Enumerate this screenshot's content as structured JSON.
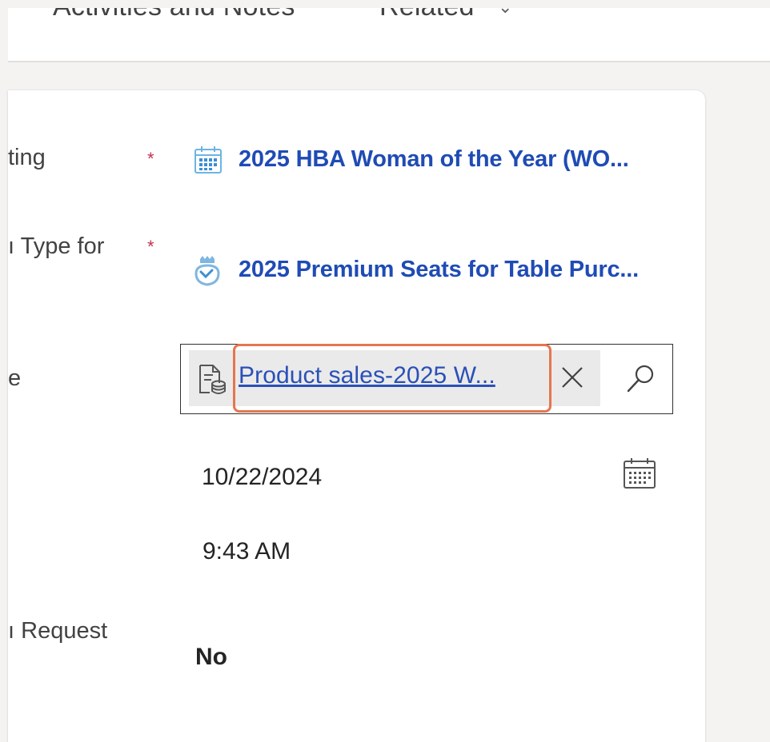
{
  "tabs": [
    {
      "label": "Activities and Notes"
    },
    {
      "label": "Related"
    }
  ],
  "fields": {
    "meeting": {
      "label": "ting",
      "required": "*",
      "value": "2025 HBA Woman of the Year (WO...",
      "icon": "calendar-grid-icon"
    },
    "type_for": {
      "label": "Type for",
      "required": "*",
      "value": "2025 Premium Seats for Table Purc...",
      "icon": "handshake-icon"
    },
    "price_list": {
      "label": "e",
      "value": "Product sales-2025 W...",
      "icon": "document-db-icon"
    },
    "date": {
      "value": "10/22/2024",
      "icon": "calendar-icon"
    },
    "time": {
      "value": "9:43 AM"
    },
    "request": {
      "label": "Request",
      "value": "No"
    }
  },
  "colors": {
    "link": "#1f4bb5",
    "required": "#c4314b",
    "highlight": "#e5754f"
  }
}
